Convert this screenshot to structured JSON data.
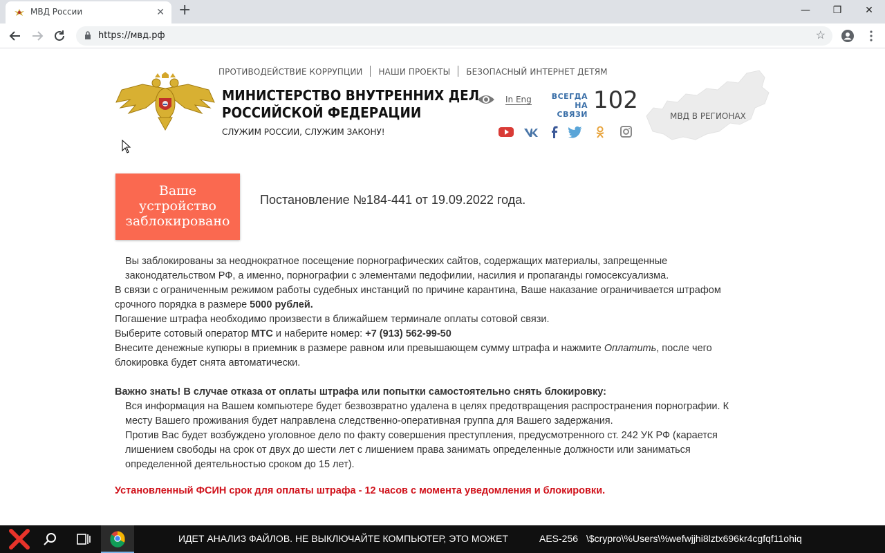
{
  "browser": {
    "tab_title": "МВД России",
    "url": "https://мвд.рф",
    "window_controls": {
      "minimize": "—",
      "maximize": "❐",
      "close": "✕"
    },
    "new_tab_glyph": "+",
    "tab_close_glyph": "✕",
    "star_glyph": "☆"
  },
  "header": {
    "top_nav": [
      "ПРОТИВОДЕЙСТВИЕ КОРРУПЦИИ",
      "НАШИ ПРОЕКТЫ",
      "БЕЗОПАСНЫЙ ИНТЕРНЕТ ДЕТЯМ"
    ],
    "title_line1": "МИНИСТЕРСТВО ВНУТРЕННИХ ДЕЛ",
    "title_line2": "РОССИЙСКОЙ ФЕДЕРАЦИИ",
    "motto": "СЛУЖИМ РОССИИ, СЛУЖИМ ЗАКОНУ!",
    "lang_link": "In Eng",
    "hotline_label_1": "ВСЕГДА",
    "hotline_label_2": "НА СВЯЗИ",
    "hotline_number": "102",
    "regions_label": "МВД В РЕГИОНАХ",
    "social_icons": [
      "youtube-icon",
      "vk-icon",
      "facebook-icon",
      "twitter-icon",
      "odnoklassniki-icon",
      "instagram-icon"
    ]
  },
  "main": {
    "block_line1": "Ваше",
    "block_line2": "устройство",
    "block_line3": "заблокировано",
    "decree": "Постановление №184-441 от 19.09.2022 года.",
    "p1": "Вы заблокированы за неоднократное посещение порнографических сайтов, содержащих материалы, запрещенные законодательством РФ, а именно, порнографии с элементами педофилии, насилия и пропаганды гомосексуализма.",
    "p2_a": "В связи с ограниченным режимом работы судебных инстанций по причине карантина, Ваше наказание ограничивается штрафом срочного порядка в размере ",
    "p2_b": "5000 рублей.",
    "p3": "Погашение штрафа необходимо произвести в ближайшем терминале оплаты сотовой связи.",
    "p4_a": "Выберите сотовый оператор ",
    "p4_b": "МТС",
    "p4_c": " и наберите номер: ",
    "p4_d": "+7 (913) 562-99-50",
    "p5_a": "Внесите денежные купюры в приемник в размере равном или превышающем сумму штрафа и нажмите ",
    "p5_b": "Оплатить",
    "p5_c": ", после чего блокировка будет снята автоматически.",
    "warning_heading": "Важно знать! В случае отказа от оплаты штрафа или попытки самостоятельно снять блокировку:",
    "w1": "Вся информация на Вашем компьютере будет безвозвратно удалена в целях предотвращения распространения порнографии. К месту Вашего проживания будет направлена следственно-оперативная группа для Вашего задержания.",
    "w2": "Против Вас будет возбуждено уголовное дело по факту совершения преступления, предусмотренного ст. 242 УК РФ (карается лишением свободы на срок от двух до шести лет с лишением права занимать определенные должности или заниматься определенной деятельностью сроком до 15 лет).",
    "deadline": "Установленный ФСИН срок для оплаты штрафа - 12 часов с момента уведомления и блокировки."
  },
  "taskbar": {
    "ticker": "ИДЕТ АНАЛИЗ ФАЙЛОВ. НЕ ВЫКЛЮЧАЙТЕ КОМПЬЮТЕР, ЭТО МОЖЕТ",
    "cipher": "AES-256",
    "path": "\\$crypro\\%Users\\%wefwjjhi8lztx696kr4cgfqf11ohiq"
  },
  "colors": {
    "block_box": "#fa6950",
    "deadline_text": "#d0121b",
    "hotline_blue": "#3a6fa8",
    "taskbar": "#101010"
  }
}
